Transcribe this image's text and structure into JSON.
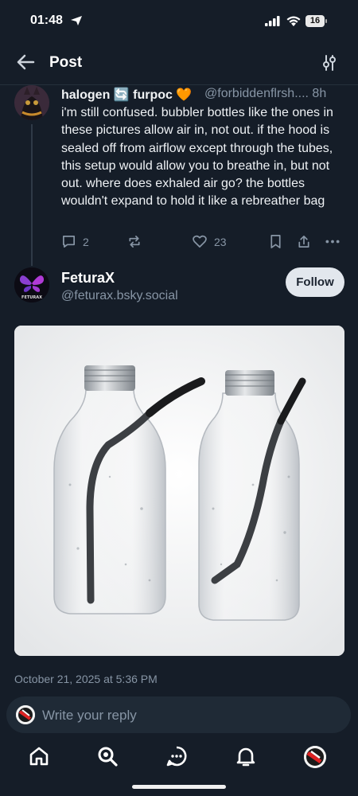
{
  "status_bar": {
    "time": "01:48",
    "battery": "16"
  },
  "header": {
    "title": "Post"
  },
  "parent_post": {
    "display_name": "halogen 🔄 furpoc 🧡",
    "handle_and_time": "@forbiddenflrsh.... 8h",
    "text": "i'm still confused. bubbler bottles like the ones in these pictures allow air in, not out. if the hood is sealed off from airflow except through the tubes, this setup would allow you to breathe in, but not out. where does exhaled air go? the bottles wouldn't expand to hold it like a rebreather bag",
    "reply_count": "2",
    "like_count": "23"
  },
  "main_post": {
    "display_name": "FeturaX",
    "handle": "@feturax.bsky.social",
    "avatar_text": "FETURAX",
    "follow_label": "Follow",
    "timestamp": "October 21, 2025 at 5:36 PM"
  },
  "composer": {
    "placeholder": "Write your reply"
  },
  "colors": {
    "background": "#151d28",
    "muted": "#8795a5",
    "follow_bg": "#e2e7ed",
    "heart": "#f59a23"
  }
}
